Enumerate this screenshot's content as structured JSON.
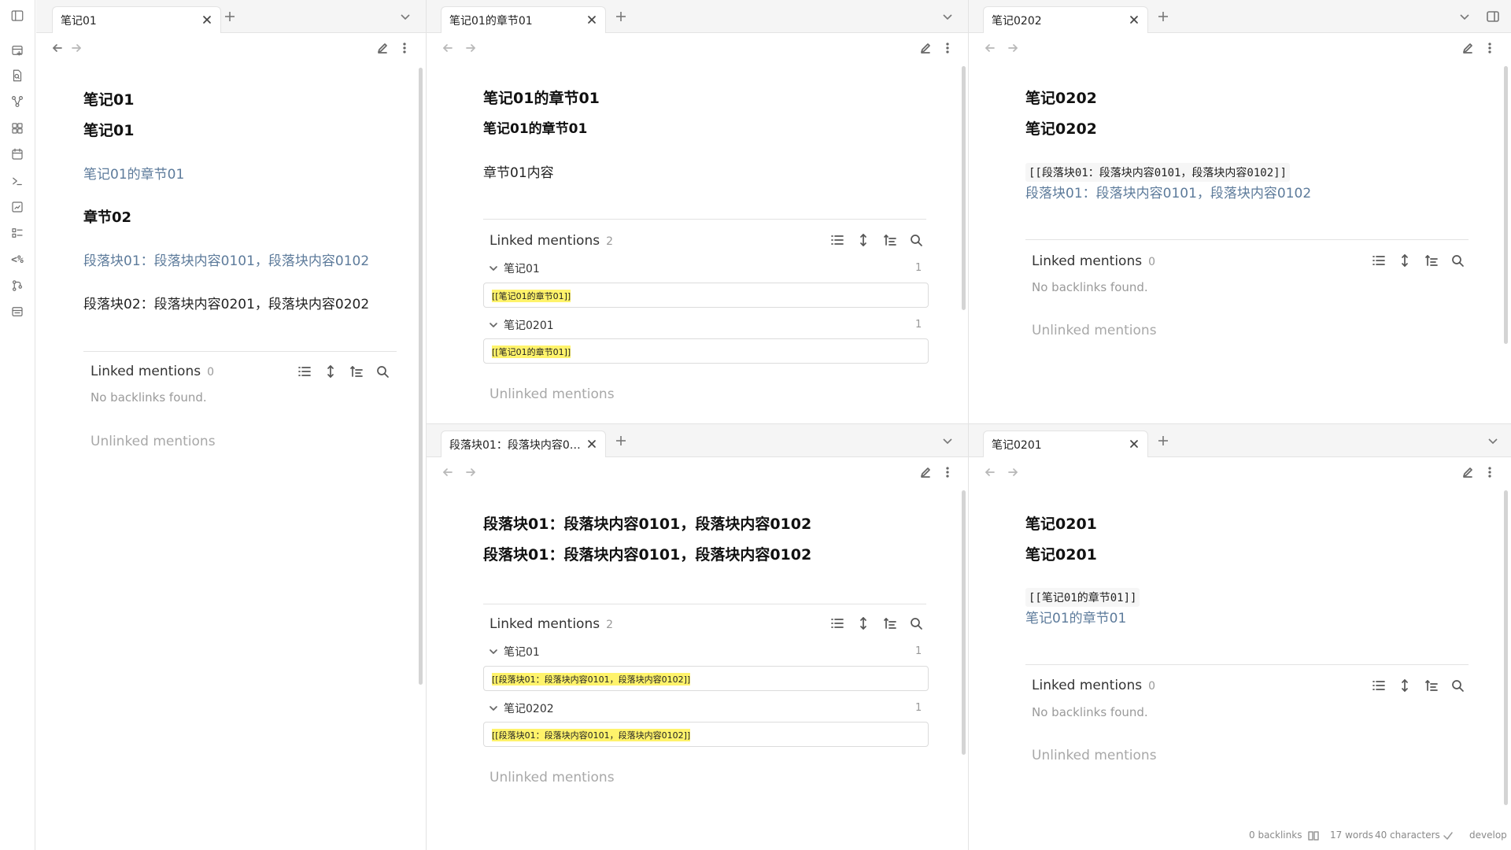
{
  "panes": {
    "p1": {
      "tab_title": "笔记01",
      "heading1": "笔记01",
      "heading2": "笔记01",
      "link1": "笔记01的章节01",
      "heading3": "章节02",
      "link2": "段落块01：段落块内容0101，段落块内容0102",
      "text1": "段落块02：段落块内容0201，段落块内容0202",
      "linked_label": "Linked mentions",
      "linked_count": "0",
      "no_backlinks": "No backlinks found.",
      "unlinked": "Unlinked mentions"
    },
    "p2": {
      "tab_title": "笔记01的章节01",
      "heading1": "笔记01的章节01",
      "heading2": "笔记01的章节01",
      "text1": "章节01内容",
      "linked_label": "Linked mentions",
      "linked_count": "2",
      "groups": [
        {
          "name": "笔记01",
          "count": "1",
          "snippet": "[[笔记01的章节01]]"
        },
        {
          "name": "笔记0201",
          "count": "1",
          "snippet": "[[笔记01的章节01]]"
        }
      ],
      "unlinked": "Unlinked mentions"
    },
    "p3": {
      "tab_title": "笔记0202",
      "heading1": "笔记0202",
      "heading2": "笔记0202",
      "code": "[[段落块01：段落块内容0101，段落块内容0102]]",
      "link1": "段落块01：段落块内容0101，段落块内容0102",
      "linked_label": "Linked mentions",
      "linked_count": "0",
      "no_backlinks": "No backlinks found.",
      "unlinked": "Unlinked mentions"
    },
    "p4": {
      "tab_title": "段落块01：段落块内容01...",
      "heading1": "段落块01：段落块内容0101，段落块内容0102",
      "heading2": "段落块01：段落块内容0101，段落块内容0102",
      "linked_label": "Linked mentions",
      "linked_count": "2",
      "groups": [
        {
          "name": "笔记01",
          "count": "1",
          "snippet": "[[段落块01：段落块内容0101，段落块内容0102]]"
        },
        {
          "name": "笔记0202",
          "count": "1",
          "snippet": "[[段落块01：段落块内容0101，段落块内容0102]]"
        }
      ],
      "unlinked": "Unlinked mentions"
    },
    "p5": {
      "tab_title": "笔记0201",
      "heading1": "笔记0201",
      "heading2": "笔记0201",
      "code": "[[笔记01的章节01]]",
      "link1": "笔记01的章节01",
      "linked_label": "Linked mentions",
      "linked_count": "0",
      "no_backlinks": "No backlinks found.",
      "unlinked": "Unlinked mentions"
    }
  },
  "status": {
    "backlinks": "0 backlinks",
    "words": "17 words",
    "characters": "40 characters",
    "branch": "develop"
  },
  "colors": {
    "link": "#5d7b9b",
    "highlight": "#fff36b",
    "muted": "#a8a8a8"
  },
  "ribbon_icons": [
    "sidebar-toggle-icon",
    "new-note-icon",
    "quick-switcher-icon",
    "graph-view-icon",
    "canvas-icon",
    "daily-note-icon",
    "command-palette-icon",
    "templates-icon",
    "outline-icon",
    "regex-icon",
    "git-icon",
    "bookmark-icon"
  ],
  "ribbon_regex_label": "<%"
}
